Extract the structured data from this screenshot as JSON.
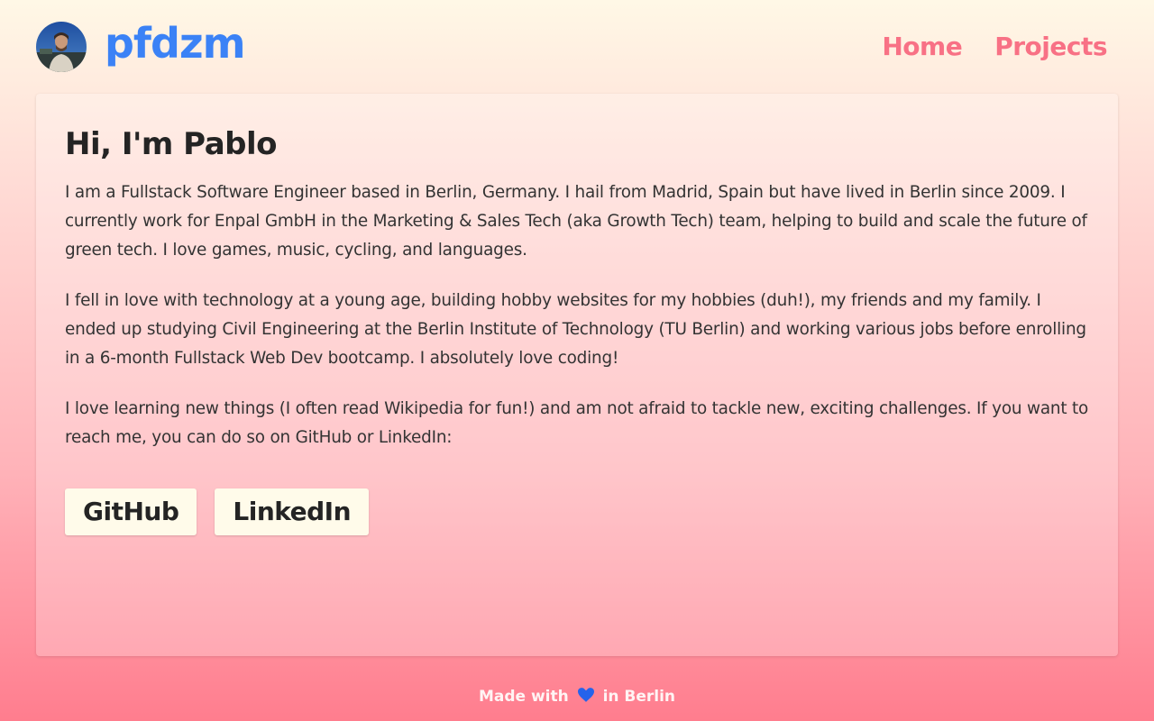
{
  "header": {
    "brand": "pfdzm",
    "nav": [
      {
        "label": "Home"
      },
      {
        "label": "Projects"
      }
    ]
  },
  "main": {
    "title": "Hi, I'm Pablo",
    "paragraphs": [
      "I am a Fullstack Software Engineer based in Berlin, Germany. I hail from Madrid, Spain but have lived in Berlin since 2009. I currently work for Enpal GmbH in the Marketing & Sales Tech (aka Growth Tech) team, helping to build and scale the future of green tech. I love games, music, cycling, and languages.",
      "I fell in love with technology at a young age, building hobby websites for my hobbies (duh!), my friends and my family. I ended up studying Civil Engineering at the Berlin Institute of Technology (TU Berlin) and working various jobs before enrolling in a 6-month Fullstack Web Dev bootcamp. I absolutely love coding!",
      "I love learning new things (I often read Wikipedia for fun!) and am not afraid to tackle new, exciting challenges. If you want to reach me, you can do so on GitHub or LinkedIn:"
    ],
    "links": [
      {
        "label": "GitHub"
      },
      {
        "label": "LinkedIn"
      }
    ]
  },
  "footer": {
    "prefix": "Made with",
    "suffix": "in Berlin",
    "heart_icon": "heart-icon"
  },
  "colors": {
    "brand": "#3b82f6",
    "nav": "#f87185",
    "heart": "#2563eb",
    "button_bg": "#fffbea"
  }
}
